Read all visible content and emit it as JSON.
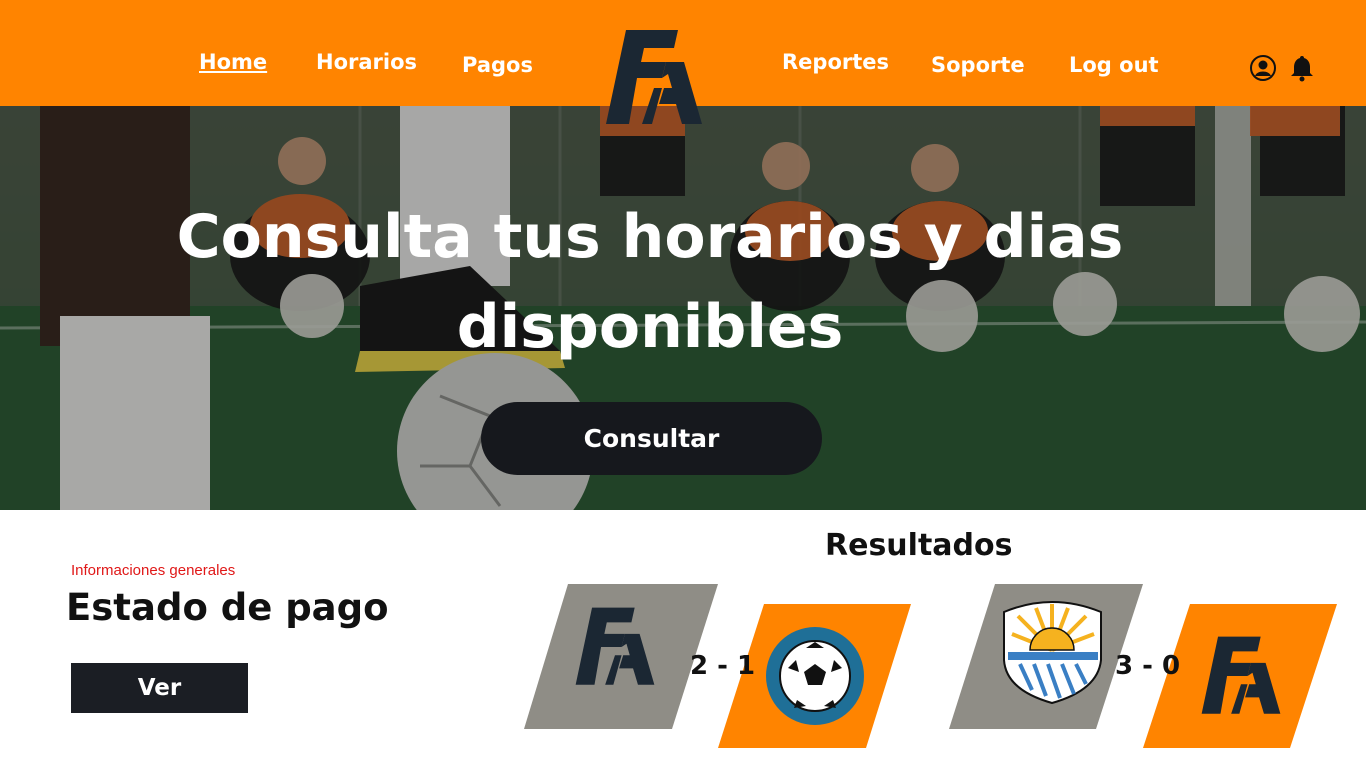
{
  "nav": {
    "items": [
      {
        "label": "Home",
        "active": true
      },
      {
        "label": "Horarios",
        "active": false
      },
      {
        "label": "Pagos",
        "active": false
      },
      {
        "label": "Reportes",
        "active": false
      },
      {
        "label": "Soporte",
        "active": false
      },
      {
        "label": "Log out",
        "active": false
      }
    ],
    "logo": "FA",
    "icons": [
      "user-icon",
      "bell-icon"
    ]
  },
  "hero": {
    "title": "Consulta tus horarios y dias disponibles",
    "cta_label": "Consultar"
  },
  "payment": {
    "label": "Informaciones generales",
    "title": "Estado de pago",
    "button_label": "Ver"
  },
  "results": {
    "title": "Resultados",
    "matches": [
      {
        "home": "FA",
        "away": "soccer-ball-badge",
        "score": "2 - 1"
      },
      {
        "home": "sunrise-crest-badge",
        "away": "FA",
        "score": "3 - 0"
      }
    ]
  },
  "colors": {
    "accent": "#ff8400",
    "dark": "#16181d",
    "grey_badge": "#8f8d86",
    "label_red": "#e01818"
  }
}
